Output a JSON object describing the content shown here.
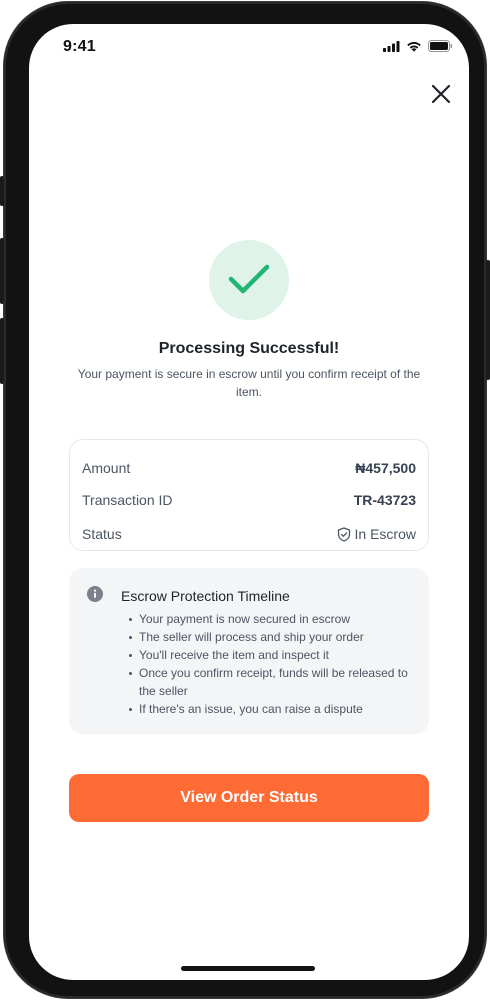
{
  "status_bar": {
    "time": "9:41",
    "icons": [
      "signal-icon",
      "wifi-icon",
      "battery-icon"
    ]
  },
  "header": {
    "close_icon": "close-icon"
  },
  "success": {
    "icon": "checkmark-icon",
    "title": "Processing Successful!",
    "message": "Your payment is secure in escrow until you confirm receipt of the item."
  },
  "details": {
    "amount_label": "Amount",
    "amount_value": "₦457,500",
    "transaction_label": "Transaction ID",
    "transaction_value": "TR-43723",
    "status_label": "Status",
    "status_value": "In Escrow",
    "status_icon": "shield-check-icon"
  },
  "timeline": {
    "icon": "info-icon",
    "title": "Escrow Protection Timeline",
    "items": [
      "Your payment is now secured in escrow",
      "The seller will process and ship your order",
      "You'll receive the item and inspect it",
      "Once you confirm receipt, funds will be released to the seller",
      "If there's an issue, you can raise a dispute"
    ]
  },
  "cta": {
    "label": "View Order Status"
  },
  "colors": {
    "accent": "#ff6b35",
    "success": "#22b573",
    "success_bg": "#dff3e8"
  }
}
